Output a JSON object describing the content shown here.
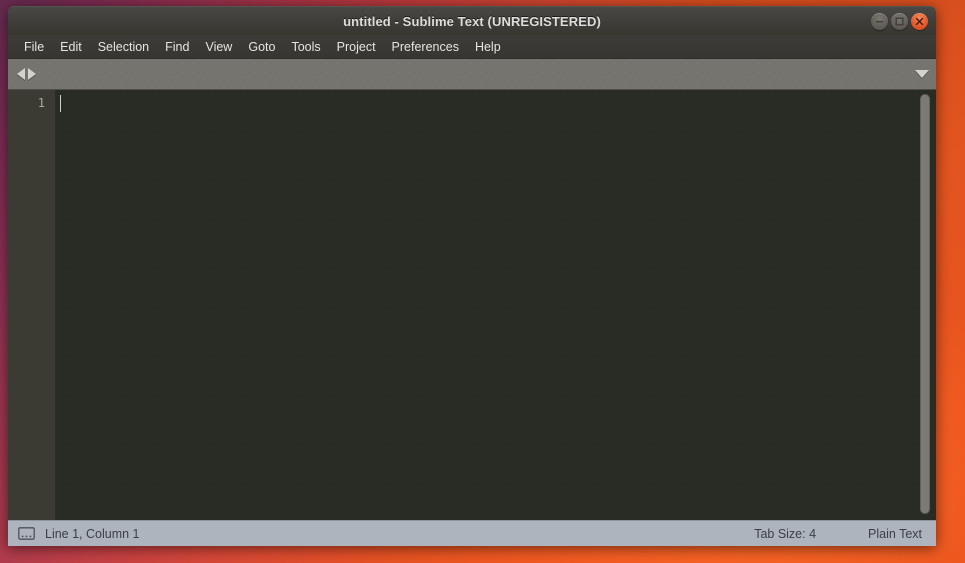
{
  "window": {
    "title": "untitled - Sublime Text (UNREGISTERED)",
    "controls": [
      {
        "name": "minimize",
        "icon": "minimize-icon",
        "label": "–"
      },
      {
        "name": "maximize",
        "icon": "maximize-icon",
        "label": "□"
      },
      {
        "name": "close",
        "icon": "close-icon",
        "label": "x"
      }
    ]
  },
  "menubar": {
    "items": [
      {
        "label": "File"
      },
      {
        "label": "Edit"
      },
      {
        "label": "Selection"
      },
      {
        "label": "Find"
      },
      {
        "label": "View"
      },
      {
        "label": "Goto"
      },
      {
        "label": "Tools"
      },
      {
        "label": "Project"
      },
      {
        "label": "Preferences"
      },
      {
        "label": "Help"
      }
    ]
  },
  "tabbar": {
    "scroll_left_icon": "triangle-left-icon",
    "scroll_right_icon": "triangle-right-icon",
    "tab_menu_icon": "chevron-down-icon",
    "tabs": []
  },
  "editor": {
    "line_numbers": [
      "1"
    ],
    "content": "",
    "scrollbar_icon": "vertical-scrollbar"
  },
  "statusbar": {
    "console_icon": "console-icon",
    "cursor_position": "Line 1, Column 1",
    "tab_size": "Tab Size: 4",
    "syntax": "Plain Text"
  },
  "colors": {
    "titlebar": "#413f3b",
    "menubar": "#3b3934",
    "tabbar": "#75746e",
    "editor_bg": "#282c24",
    "gutter_bg": "#3b3a33",
    "statusbar_bg": "#aeb4bd",
    "close_button": "#e2562a",
    "desktop": "#ef5620"
  }
}
